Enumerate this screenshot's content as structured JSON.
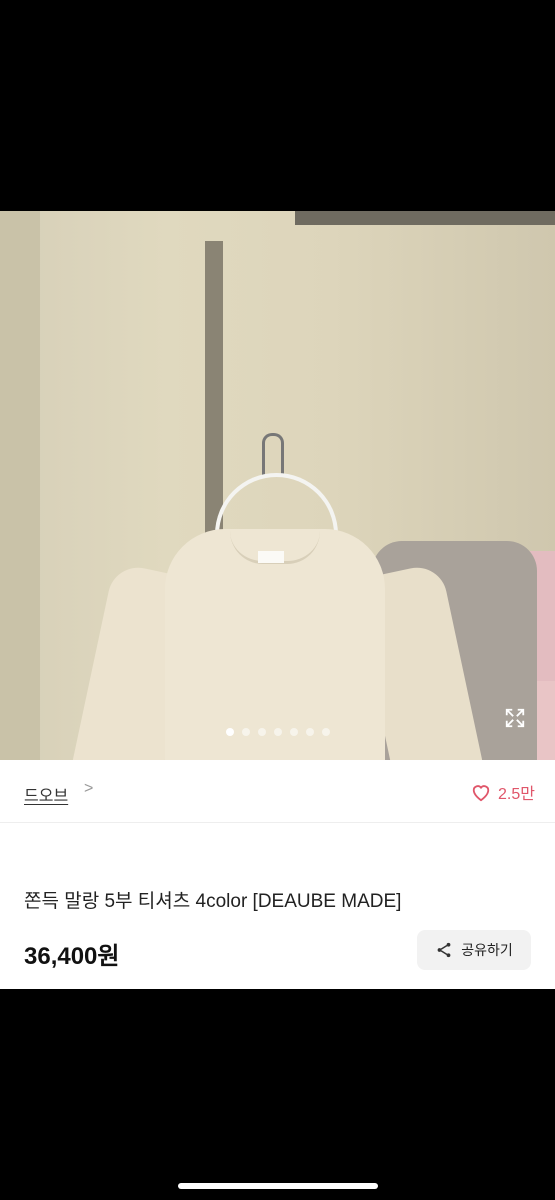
{
  "carousel": {
    "active_index": 0,
    "dot_count": 7
  },
  "brand": {
    "name": "드오브",
    "chevron": ">"
  },
  "likes": {
    "count": "2.5만"
  },
  "product": {
    "title": "쫀득 말랑 5부 티셔츠 4color [DEAUBE MADE]",
    "price": "36,400",
    "price_unit": "원"
  },
  "share_button": {
    "label": "공유하기"
  },
  "colors": {
    "heart": "#e0566a",
    "share_bg": "#f2f2f2"
  }
}
